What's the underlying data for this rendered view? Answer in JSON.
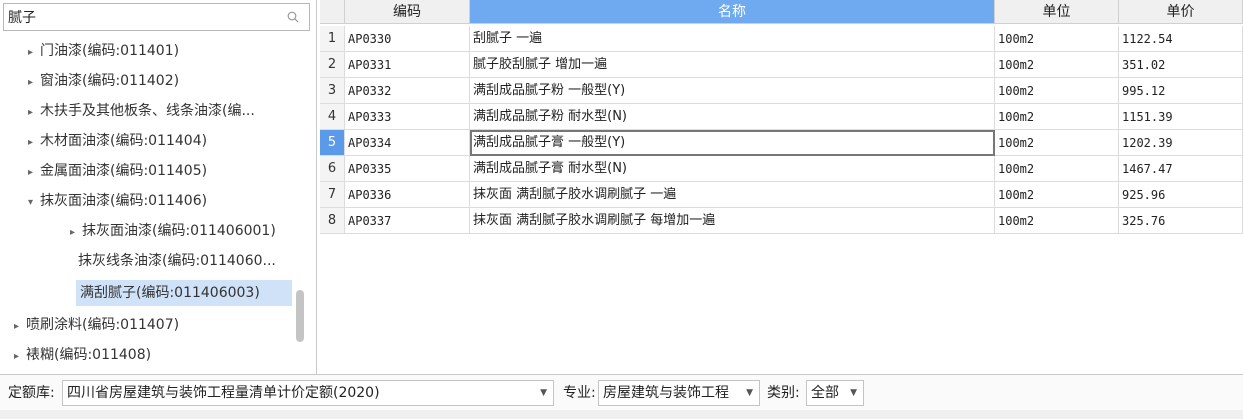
{
  "search": {
    "value": "腻子"
  },
  "tree": [
    {
      "label": "门油漆(编码:011401)",
      "arrow": "▸"
    },
    {
      "label": "窗油漆(编码:011402)",
      "arrow": "▸"
    },
    {
      "label": "木扶手及其他板条、线条油漆(编...",
      "arrow": "▸"
    },
    {
      "label": "木材面油漆(编码:011404)",
      "arrow": "▸"
    },
    {
      "label": "金属面油漆(编码:011405)",
      "arrow": "▸"
    },
    {
      "label": "抹灰面油漆(编码:011406)",
      "arrow": "▾"
    },
    {
      "label": "抹灰面油漆(编码:011406001)",
      "arrow": "▸"
    },
    {
      "label": "抹灰线条油漆(编码:0114060...",
      "arrow": ""
    },
    {
      "label": "满刮腻子(编码:011406003)",
      "arrow": ""
    },
    {
      "label": "喷刷涂料(编码:011407)",
      "arrow": "▸"
    },
    {
      "label": "裱糊(编码:011408)",
      "arrow": "▸"
    }
  ],
  "grid": {
    "headers": {
      "code": "编码",
      "name": "名称",
      "unit": "单位",
      "price": "单价"
    },
    "rows": [
      {
        "n": "1",
        "code": "AP0330",
        "name": "刮腻子 一遍",
        "unit": "100m2",
        "price": "1122.54"
      },
      {
        "n": "2",
        "code": "AP0331",
        "name": "腻子胶刮腻子 增加一遍",
        "unit": "100m2",
        "price": "351.02"
      },
      {
        "n": "3",
        "code": "AP0332",
        "name": "满刮成品腻子粉 一般型(Y)",
        "unit": "100m2",
        "price": "995.12"
      },
      {
        "n": "4",
        "code": "AP0333",
        "name": "满刮成品腻子粉 耐水型(N)",
        "unit": "100m2",
        "price": "1151.39"
      },
      {
        "n": "5",
        "code": "AP0334",
        "name": "满刮成品腻子膏 一般型(Y)",
        "unit": "100m2",
        "price": "1202.39"
      },
      {
        "n": "6",
        "code": "AP0335",
        "name": "满刮成品腻子膏 耐水型(N)",
        "unit": "100m2",
        "price": "1467.47"
      },
      {
        "n": "7",
        "code": "AP0336",
        "name": "抹灰面 满刮腻子胶水调刷腻子 一遍",
        "unit": "100m2",
        "price": "925.96"
      },
      {
        "n": "8",
        "code": "AP0337",
        "name": "抹灰面 满刮腻子胶水调刷腻子 每增加一遍",
        "unit": "100m2",
        "price": "325.76"
      }
    ]
  },
  "bottom": {
    "quota_label": "定额库:",
    "quota_value": "四川省房屋建筑与装饰工程量清单计价定额(2020)",
    "major_label": "专业:",
    "major_value": "房屋建筑与装饰工程",
    "category_label": "类别:",
    "category_value": "全部"
  },
  "colors": {
    "header_active": "#6faaf0",
    "selection": "#cfe2f7",
    "row_current": "#5b9ae8"
  }
}
